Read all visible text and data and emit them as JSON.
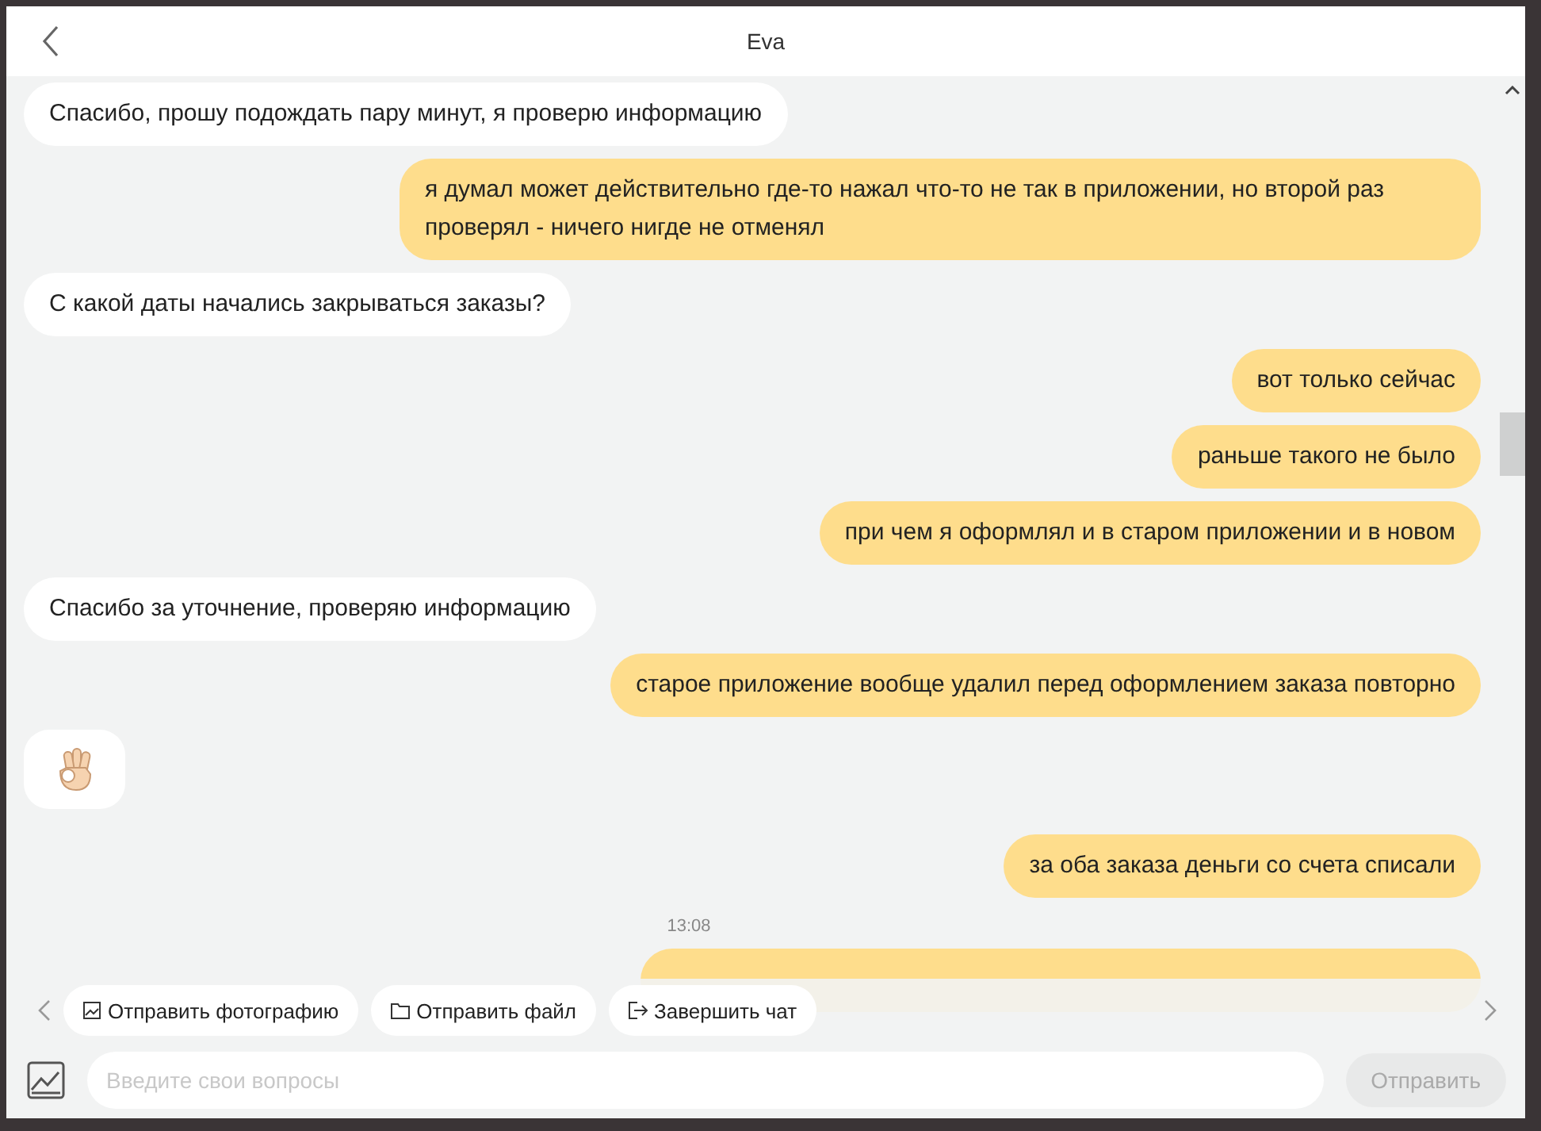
{
  "header": {
    "title": "Eva"
  },
  "messages": [
    {
      "kind": "agent",
      "text": "Спасибо, прошу подождать пару минут, я проверю информацию"
    },
    {
      "kind": "user",
      "text": "я думал может действительно где-то нажал что-то не так в приложении, но второй раз проверял - ничего нигде не отменял"
    },
    {
      "kind": "agent",
      "text": "С какой даты начались закрываться заказы?"
    },
    {
      "kind": "user",
      "text": "вот только сейчас"
    },
    {
      "kind": "user",
      "text": "раньше такого не было"
    },
    {
      "kind": "user",
      "text": "при чем я оформлял и в старом приложении и в новом"
    },
    {
      "kind": "agent",
      "text": "Спасибо за уточнение, проверяю информацию"
    },
    {
      "kind": "user",
      "text": "старое приложение вообще удалил перед оформлением заказа повторно"
    },
    {
      "kind": "sticker"
    },
    {
      "kind": "user",
      "text": "за оба заказа деньги со счета списали"
    },
    {
      "kind": "time",
      "text": "13:08"
    },
    {
      "kind": "covered"
    }
  ],
  "quick_actions": [
    {
      "kind": "photo",
      "label": "Отправить фотографию"
    },
    {
      "kind": "file",
      "label": "Отправить файл"
    },
    {
      "kind": "end",
      "label": "Завершить чат"
    }
  ],
  "composer": {
    "placeholder": "Введите свои вопросы",
    "send": "Отправить",
    "send_disabled": true
  }
}
